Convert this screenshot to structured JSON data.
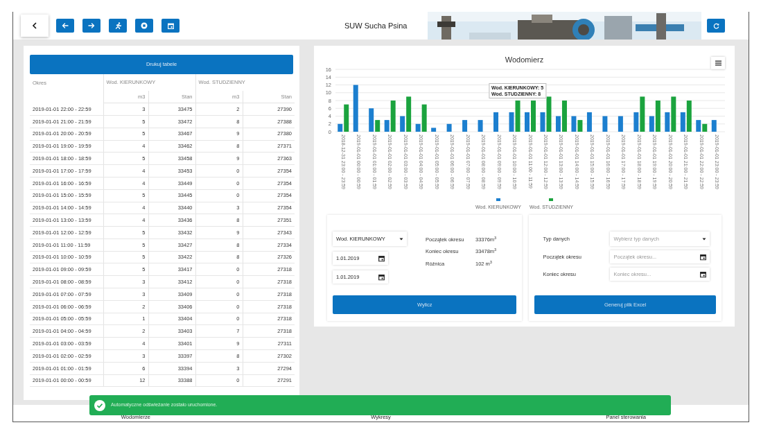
{
  "header": {
    "title": "SUW Sucha Psina"
  },
  "table": {
    "print_button": "Drukuj tabele",
    "columns": [
      {
        "label": "Okres"
      },
      {
        "label": "Wod. KIERUNKOWY",
        "colspan": 2,
        "sub": [
          "m3",
          "Stan"
        ]
      },
      {
        "label": "Wod. STUDZIENNY",
        "colspan": 2,
        "sub": [
          "m3",
          "Stan"
        ]
      }
    ],
    "rows": [
      [
        "2019-01-01 22:00 - 22:59",
        "3",
        "33475",
        "2",
        "27390"
      ],
      [
        "2019-01-01 21:00 - 21:59",
        "5",
        "33472",
        "8",
        "27388"
      ],
      [
        "2019-01-01 20:00 - 20:59",
        "5",
        "33467",
        "9",
        "27380"
      ],
      [
        "2019-01-01 19:00 - 19:59",
        "4",
        "33462",
        "8",
        "27371"
      ],
      [
        "2019-01-01 18:00 - 18:59",
        "5",
        "33458",
        "9",
        "27363"
      ],
      [
        "2019-01-01 17:00 - 17:59",
        "4",
        "33453",
        "0",
        "27354"
      ],
      [
        "2019-01-01 16:00 - 16:59",
        "4",
        "33449",
        "0",
        "27354"
      ],
      [
        "2019-01-01 15:00 - 15:59",
        "5",
        "33445",
        "0",
        "27354"
      ],
      [
        "2019-01-01 14:00 - 14:59",
        "4",
        "33440",
        "3",
        "27354"
      ],
      [
        "2019-01-01 13:00 - 13:59",
        "4",
        "33436",
        "8",
        "27351"
      ],
      [
        "2019-01-01 12:00 - 12:59",
        "5",
        "33432",
        "9",
        "27343"
      ],
      [
        "2019-01-01 11:00 - 11:59",
        "5",
        "33427",
        "8",
        "27334"
      ],
      [
        "2019-01-01 10:00 - 10:59",
        "5",
        "33422",
        "8",
        "27326"
      ],
      [
        "2019-01-01 09:00 - 09:59",
        "5",
        "33417",
        "0",
        "27318"
      ],
      [
        "2019-01-01 08:00 - 08:59",
        "3",
        "33412",
        "0",
        "27318"
      ],
      [
        "2019-01-01 07:00 - 07:59",
        "3",
        "33409",
        "0",
        "27318"
      ],
      [
        "2019-01-01 06:00 - 06:59",
        "2",
        "33406",
        "0",
        "27318"
      ],
      [
        "2019-01-01 05:00 - 05:59",
        "1",
        "33404",
        "0",
        "27318"
      ],
      [
        "2019-01-01 04:00 - 04:59",
        "2",
        "33403",
        "7",
        "27318"
      ],
      [
        "2019-01-01 03:00 - 03:59",
        "4",
        "33401",
        "9",
        "27311"
      ],
      [
        "2019-01-01 02:00 - 02:59",
        "3",
        "33397",
        "8",
        "27302"
      ],
      [
        "2019-01-01 01:00 - 01:59",
        "6",
        "33394",
        "3",
        "27294"
      ],
      [
        "2019-01-01 00:00 - 00:59",
        "12",
        "33388",
        "0",
        "27291"
      ]
    ]
  },
  "chart": {
    "chart_data": {
      "type": "bar",
      "title": "Wodomierz",
      "categories": [
        "2018-12-31 23:00 - 23:59",
        "2019-01-01 00:00 - 00:59",
        "2019-01-01 01:00 - 01:59",
        "2019-01-01 02:00 - 02:59",
        "2019-01-01 03:00 - 03:59",
        "2019-01-01 04:00 - 04:59",
        "2019-01-01 05:00 - 05:59",
        "2019-01-01 06:00 - 06:59",
        "2019-01-01 07:00 - 07:59",
        "2019-01-01 08:00 - 08:59",
        "2019-01-01 09:00 - 09:59",
        "2019-01-01 10:00 - 10:59",
        "2019-01-01 11:00 - 11:59",
        "2019-01-01 12:00 - 12:59",
        "2019-01-01 13:00 - 13:59",
        "2019-01-01 14:00 - 14:59",
        "2019-01-01 15:00 - 15:59",
        "2019-01-01 16:00 - 16:59",
        "2019-01-01 17:00 - 17:59",
        "2019-01-01 18:00 - 18:59",
        "2019-01-01 19:00 - 19:59",
        "2019-01-01 20:00 - 20:59",
        "2019-01-01 21:00 - 21:59",
        "2019-01-01 22:00 - 22:59",
        "2019-01-01 23:00 - 23:59"
      ],
      "series": [
        {
          "name": "Wod. KIERUNKOWY",
          "color": "#1c7fcf",
          "values": [
            2,
            12,
            6,
            3,
            4,
            2,
            1,
            2,
            3,
            3,
            5,
            5,
            5,
            5,
            4,
            4,
            5,
            4,
            4,
            5,
            4,
            5,
            5,
            3,
            3
          ]
        },
        {
          "name": "Wod. STUDZIENNY",
          "color": "#1ba33e",
          "values": [
            7,
            0,
            3,
            8,
            9,
            7,
            0,
            0,
            0,
            0,
            0,
            8,
            8,
            9,
            8,
            3,
            0,
            0,
            0,
            9,
            8,
            9,
            8,
            2,
            0
          ]
        }
      ],
      "ylim": [
        0,
        16
      ],
      "yticks": [
        0,
        2,
        4,
        6,
        8,
        10,
        12,
        14,
        16
      ],
      "grid": true,
      "annotations": [
        "Wod. KIERUNKOWY: 5",
        "Wod. STUDZIENNY: 8"
      ]
    }
  },
  "calculator": {
    "meter_select": "Wod. KIERUNKOWY",
    "date_from": "1.01.2019",
    "date_to": "1.01.2019",
    "results": [
      {
        "label": "Początek okresu",
        "value": "33376m$^{3}$"
      },
      {
        "label": "Koniec okresu",
        "value": "33478m$^{3}$"
      },
      {
        "label": "Różnica",
        "value": "102 m$^{3}$"
      }
    ],
    "button": "Wylicz"
  },
  "export": {
    "fields": [
      {
        "label": "Typ danych",
        "placeholder": "Wybierz typ danych",
        "kind": "select"
      },
      {
        "label": "Początek okresu",
        "placeholder": "Początek okresu...",
        "kind": "date"
      },
      {
        "label": "Koniec okresu",
        "placeholder": "Koniec okresu...",
        "kind": "date"
      }
    ],
    "button": "Generuj plik Excel"
  },
  "toast": {
    "text": "Automatyczne odświeżanie zostało uruchomione."
  },
  "bottom_nav": [
    {
      "label": "Wodomierze"
    },
    {
      "label": "Wykresy"
    },
    {
      "label": "Panel sterowania"
    }
  ]
}
